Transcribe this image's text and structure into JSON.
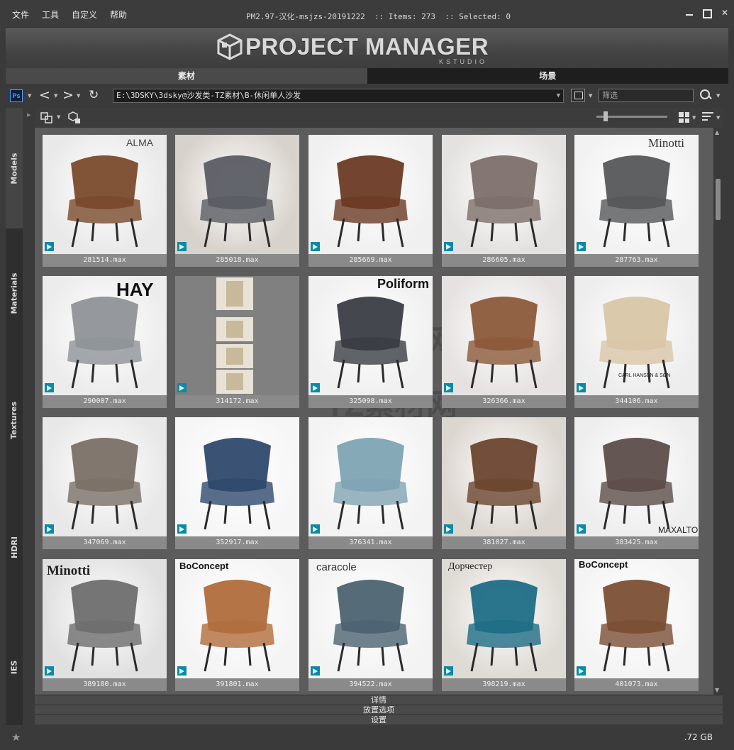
{
  "menu": [
    "文件",
    "工具",
    "自定义",
    "帮助"
  ],
  "window_title": "PM2.97-汉化-msjzs-20191222  :: Items: 273  :: Selected: 0",
  "logo": {
    "main": "PROJECT MANAGER",
    "sub": "KSTUDIO"
  },
  "tabs": [
    {
      "label": "素材",
      "active": true
    },
    {
      "label": "场景",
      "active": false
    }
  ],
  "path": "E:\\3DSKY\\3dsky@沙发类-TZ素材\\B-休闲单人沙发",
  "search": {
    "placeholder": "筛选"
  },
  "side_tabs": [
    "Models",
    "Materials",
    "Textures",
    "HDRI",
    "IES"
  ],
  "items": [
    {
      "file": "281514.max",
      "brand": "ALMA"
    },
    {
      "file": "285018.max",
      "brand": ""
    },
    {
      "file": "285669.max",
      "brand": ""
    },
    {
      "file": "286605.max",
      "brand": ""
    },
    {
      "file": "287763.max",
      "brand": "Minotti"
    },
    {
      "file": "290007.max",
      "brand": "HAY"
    },
    {
      "file": "314172.max",
      "brand": ""
    },
    {
      "file": "325098.max",
      "brand": "Poliform"
    },
    {
      "file": "326366.max",
      "brand": ""
    },
    {
      "file": "344106.max",
      "brand": "CARL HANSEN & SØN"
    },
    {
      "file": "347069.max",
      "brand": ""
    },
    {
      "file": "352917.max",
      "brand": ""
    },
    {
      "file": "376341.max",
      "brand": ""
    },
    {
      "file": "381027.max",
      "brand": ""
    },
    {
      "file": "383425.max",
      "brand": "MAXALTO"
    },
    {
      "file": "389180.max",
      "brand": "Minotti"
    },
    {
      "file": "391801.max",
      "brand": "BoConcept"
    },
    {
      "file": "394522.max",
      "brand": "caracole"
    },
    {
      "file": "398219.max",
      "brand": "Дорчестер"
    },
    {
      "file": "401073.max",
      "brand": "BoConcept"
    }
  ],
  "panels": [
    "详情",
    "放置选项",
    "设置"
  ],
  "status": {
    "disk": ".72 GB"
  }
}
